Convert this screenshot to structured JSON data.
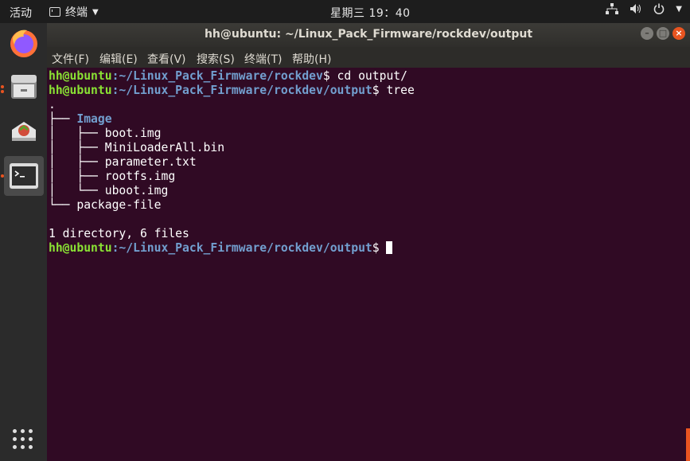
{
  "topbar": {
    "activities": "活动",
    "app_name": "终端",
    "clock": "星期三 19：40"
  },
  "dock": {
    "items": [
      "firefox-icon",
      "files-icon",
      "software-icon",
      "terminal-icon"
    ]
  },
  "window": {
    "title": "hh@ubuntu: ~/Linux_Pack_Firmware/rockdev/output",
    "menu": [
      "文件(F)",
      "编辑(E)",
      "查看(V)",
      "搜索(S)",
      "终端(T)",
      "帮助(H)"
    ]
  },
  "terminal": {
    "user_host": "hh@ubuntu",
    "path1": ":~/Linux_Pack_Firmware/rockdev",
    "cmd1": "$ cd output/",
    "path2": ":~/Linux_Pack_Firmware/rockdev/output",
    "cmd2": "$ tree",
    "tree": {
      "root": ".",
      "branch_dir": "├── ",
      "dir": "Image",
      "files": [
        "│   ├── boot.img",
        "│   ├── MiniLoaderAll.bin",
        "│   ├── parameter.txt",
        "│   ├── rootfs.img",
        "│   └── uboot.img"
      ],
      "last": "└── package-file"
    },
    "summary": "1 directory, 6 files",
    "prompt_end": "$ "
  },
  "colors": {
    "terminal_bg": "#300a24",
    "user_green": "#8ae234",
    "path_blue": "#729fcf",
    "accent_orange": "#e95420"
  }
}
